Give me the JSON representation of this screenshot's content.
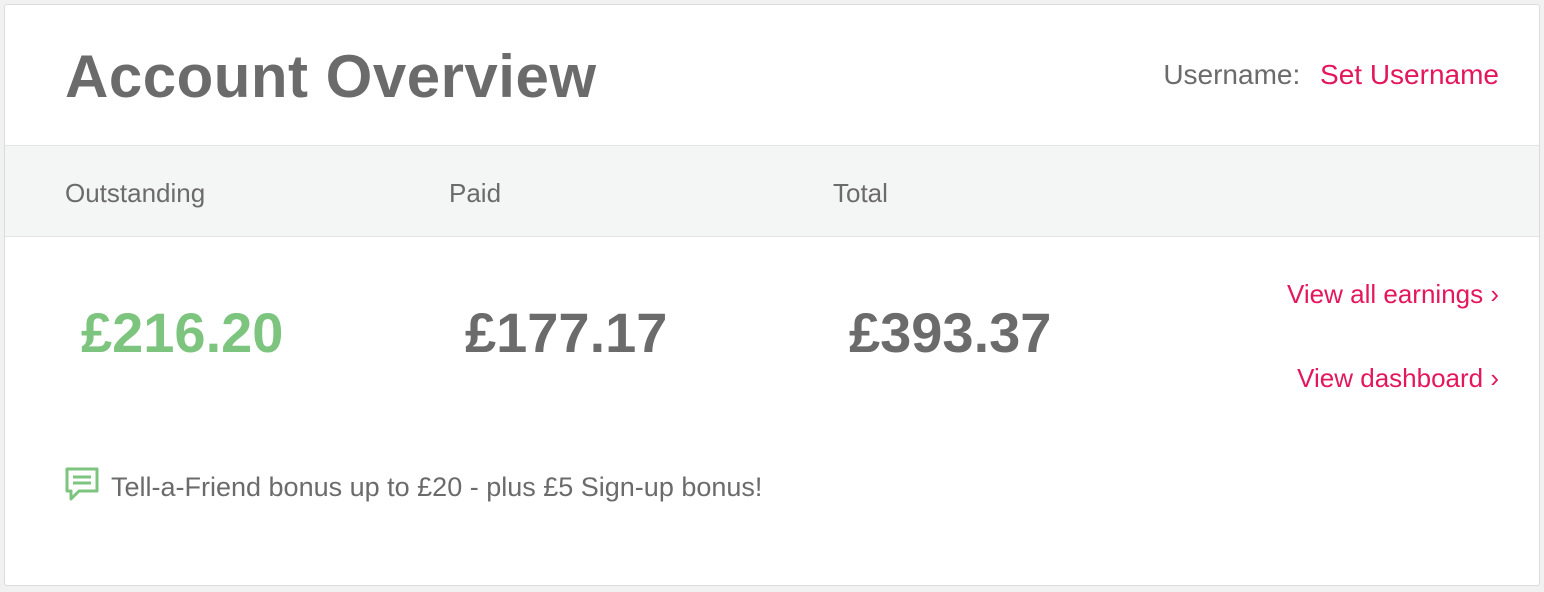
{
  "header": {
    "title": "Account Overview",
    "username_label": "Username:",
    "username_link": "Set Username"
  },
  "columns": {
    "outstanding": "Outstanding",
    "paid": "Paid",
    "total": "Total"
  },
  "amounts": {
    "outstanding": "£216.20",
    "paid": "£177.17",
    "total": "£393.37"
  },
  "links": {
    "view_all_earnings": "View all earnings ›",
    "view_dashboard": "View dashboard ›"
  },
  "promo": {
    "icon": "speech-bubble-icon",
    "text": "Tell-a-Friend bonus up to £20 - plus £5 Sign-up bonus!"
  },
  "colors": {
    "accent": "#e4175b",
    "positive": "#7dc47f",
    "text": "#6b6b6b",
    "band": "#f4f6f5"
  }
}
